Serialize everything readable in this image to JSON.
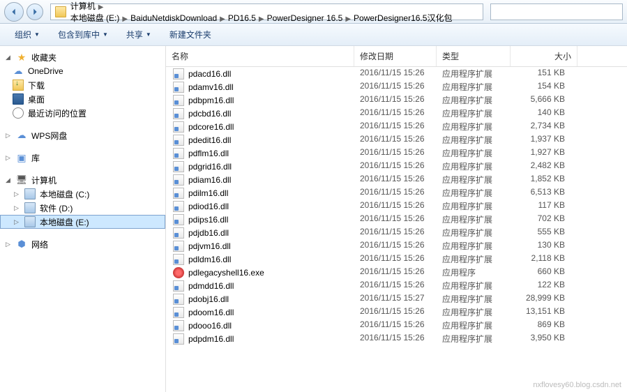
{
  "breadcrumbs": [
    "计算机",
    "本地磁盘 (E:)",
    "BaiduNetdiskDownload",
    "PD16.5",
    "PowerDesigner 16.5",
    "PowerDesigner16.5汉化包"
  ],
  "toolbar": {
    "organize": "组织",
    "include": "包含到库中",
    "share": "共享",
    "newfolder": "新建文件夹"
  },
  "sidebar": {
    "fav": {
      "label": "收藏夹",
      "items": [
        {
          "k": "onedrive",
          "label": "OneDrive"
        },
        {
          "k": "downloads",
          "label": "下载"
        },
        {
          "k": "desktop",
          "label": "桌面"
        },
        {
          "k": "recent",
          "label": "最近访问的位置"
        }
      ]
    },
    "wps": {
      "label": "WPS网盘"
    },
    "lib": {
      "label": "库"
    },
    "comp": {
      "label": "计算机",
      "items": [
        {
          "k": "c",
          "label": "本地磁盘 (C:)"
        },
        {
          "k": "d",
          "label": "软件 (D:)"
        },
        {
          "k": "e",
          "label": "本地磁盘 (E:)",
          "sel": true
        }
      ]
    },
    "net": {
      "label": "网络"
    }
  },
  "columns": {
    "name": "名称",
    "date": "修改日期",
    "type": "类型",
    "size": "大小"
  },
  "files": [
    {
      "n": "pdacd16.dll",
      "d": "2016/11/15 15:26",
      "t": "应用程序扩展",
      "s": "151 KB",
      "i": "dll"
    },
    {
      "n": "pdamv16.dll",
      "d": "2016/11/15 15:26",
      "t": "应用程序扩展",
      "s": "154 KB",
      "i": "dll"
    },
    {
      "n": "pdbpm16.dll",
      "d": "2016/11/15 15:26",
      "t": "应用程序扩展",
      "s": "5,666 KB",
      "i": "dll"
    },
    {
      "n": "pdcbd16.dll",
      "d": "2016/11/15 15:26",
      "t": "应用程序扩展",
      "s": "140 KB",
      "i": "dll"
    },
    {
      "n": "pdcore16.dll",
      "d": "2016/11/15 15:26",
      "t": "应用程序扩展",
      "s": "2,734 KB",
      "i": "dll"
    },
    {
      "n": "pdedit16.dll",
      "d": "2016/11/15 15:26",
      "t": "应用程序扩展",
      "s": "1,937 KB",
      "i": "dll"
    },
    {
      "n": "pdflm16.dll",
      "d": "2016/11/15 15:26",
      "t": "应用程序扩展",
      "s": "1,927 KB",
      "i": "dll"
    },
    {
      "n": "pdgrid16.dll",
      "d": "2016/11/15 15:26",
      "t": "应用程序扩展",
      "s": "2,482 KB",
      "i": "dll"
    },
    {
      "n": "pdiam16.dll",
      "d": "2016/11/15 15:26",
      "t": "应用程序扩展",
      "s": "1,852 KB",
      "i": "dll"
    },
    {
      "n": "pdilm16.dll",
      "d": "2016/11/15 15:26",
      "t": "应用程序扩展",
      "s": "6,513 KB",
      "i": "dll"
    },
    {
      "n": "pdiod16.dll",
      "d": "2016/11/15 15:26",
      "t": "应用程序扩展",
      "s": "117 KB",
      "i": "dll"
    },
    {
      "n": "pdips16.dll",
      "d": "2016/11/15 15:26",
      "t": "应用程序扩展",
      "s": "702 KB",
      "i": "dll"
    },
    {
      "n": "pdjdb16.dll",
      "d": "2016/11/15 15:26",
      "t": "应用程序扩展",
      "s": "555 KB",
      "i": "dll"
    },
    {
      "n": "pdjvm16.dll",
      "d": "2016/11/15 15:26",
      "t": "应用程序扩展",
      "s": "130 KB",
      "i": "dll"
    },
    {
      "n": "pdldm16.dll",
      "d": "2016/11/15 15:26",
      "t": "应用程序扩展",
      "s": "2,118 KB",
      "i": "dll"
    },
    {
      "n": "pdlegacyshell16.exe",
      "d": "2016/11/15 15:26",
      "t": "应用程序",
      "s": "660 KB",
      "i": "exe"
    },
    {
      "n": "pdmdd16.dll",
      "d": "2016/11/15 15:26",
      "t": "应用程序扩展",
      "s": "122 KB",
      "i": "dll"
    },
    {
      "n": "pdobj16.dll",
      "d": "2016/11/15 15:27",
      "t": "应用程序扩展",
      "s": "28,999 KB",
      "i": "dll"
    },
    {
      "n": "pdoom16.dll",
      "d": "2016/11/15 15:26",
      "t": "应用程序扩展",
      "s": "13,151 KB",
      "i": "dll"
    },
    {
      "n": "pdooo16.dll",
      "d": "2016/11/15 15:26",
      "t": "应用程序扩展",
      "s": "869 KB",
      "i": "dll"
    },
    {
      "n": "pdpdm16.dll",
      "d": "2016/11/15 15:26",
      "t": "应用程序扩展",
      "s": "3,950 KB",
      "i": "dll"
    }
  ],
  "watermark": "nxflovesy60.blog.csdn.net"
}
